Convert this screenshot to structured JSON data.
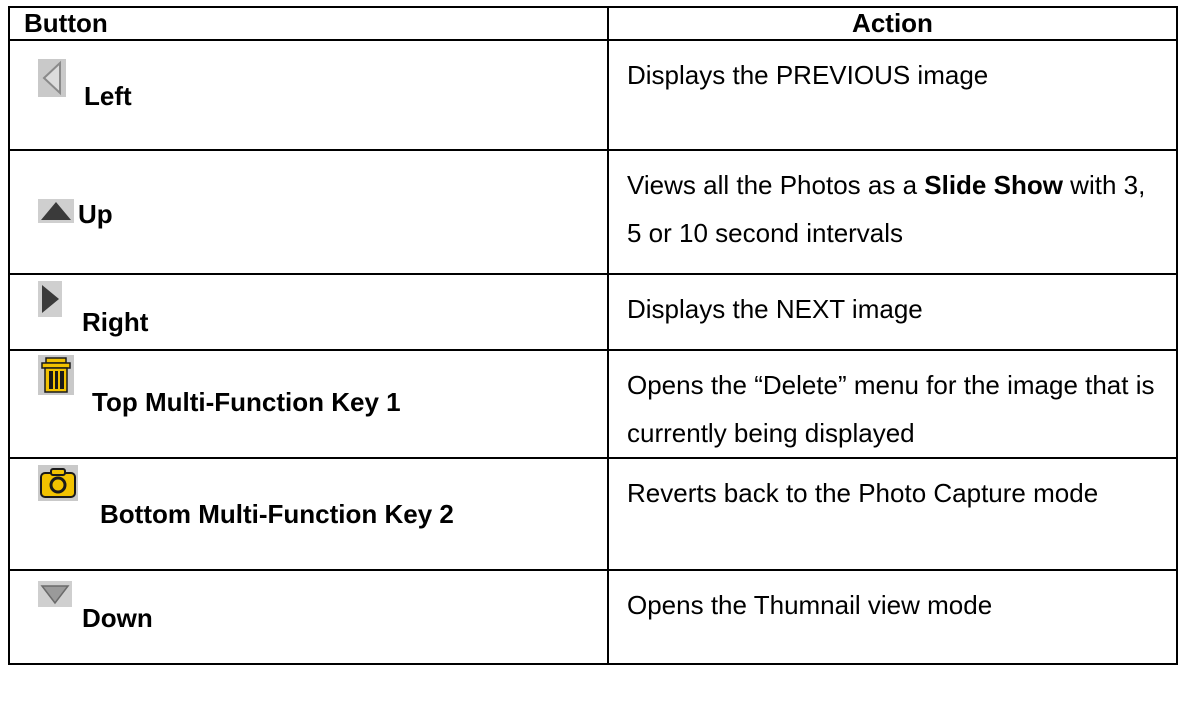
{
  "table": {
    "headers": {
      "button": "Button",
      "action": "Action"
    },
    "rows": [
      {
        "icon": "left-arrow-icon",
        "label": "Left",
        "action": "Displays the PREVIOUS image"
      },
      {
        "icon": "up-arrow-icon",
        "label": "Up",
        "action_pre": "Views all the Photos as a ",
        "action_bold": "Slide Show",
        "action_post": " with 3, 5 or 10 second intervals"
      },
      {
        "icon": "right-arrow-icon",
        "label": "Right",
        "action": "Displays the NEXT image"
      },
      {
        "icon": "trash-icon",
        "label": "Top Multi-Function Key 1",
        "action": "Opens the “Delete” menu for the image that is currently being displayed"
      },
      {
        "icon": "camera-icon",
        "label": "Bottom Multi-Function Key 2",
        "action": "Reverts back to the Photo Capture mode"
      },
      {
        "icon": "down-arrow-icon",
        "label": "Down",
        "action": "Opens the Thumnail view mode"
      }
    ]
  },
  "colors": {
    "icon_gray": "#b9b9b9",
    "arrow_dark": "#3a3a3a",
    "icon_yellow": "#f2c200"
  }
}
